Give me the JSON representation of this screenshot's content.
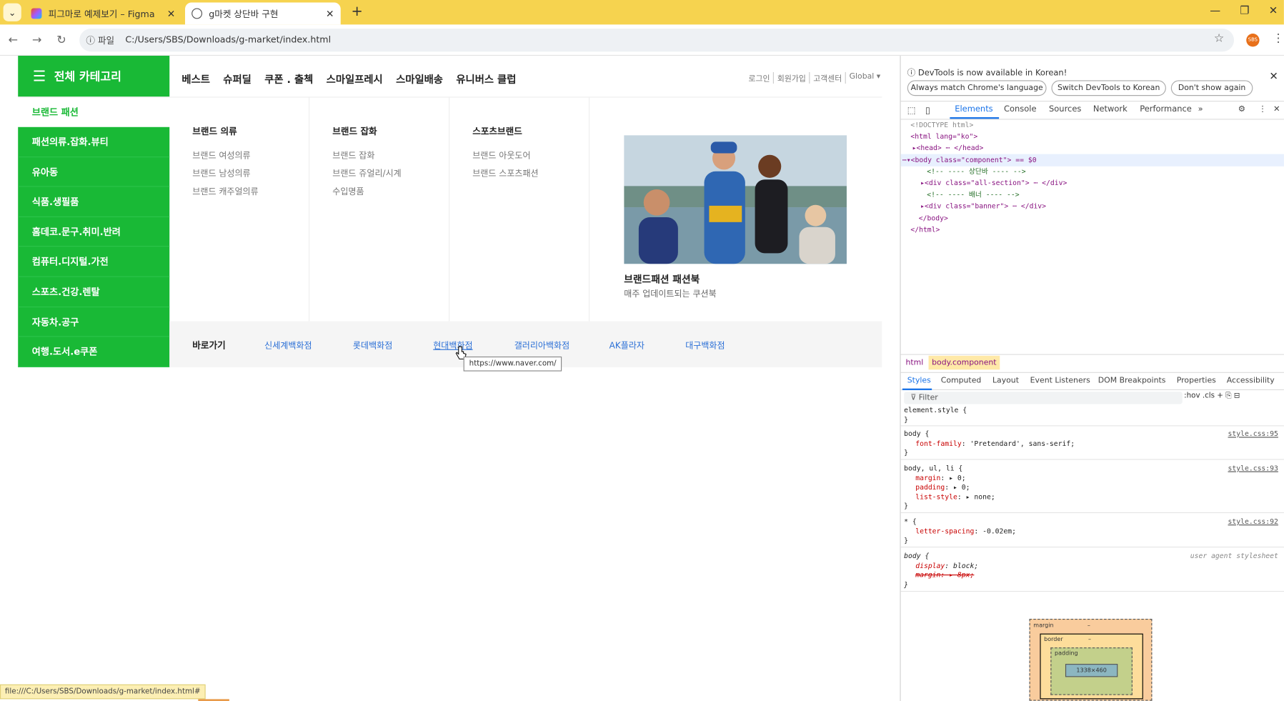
{
  "browser": {
    "tabs": [
      {
        "title": "피그마로 예제보기 – Figma",
        "close": "✕"
      },
      {
        "title": "g마켓 상단바 구현",
        "close": "✕"
      }
    ],
    "new_tab": "+",
    "window_controls": {
      "minimize": "—",
      "restore": "❐",
      "close": "✕"
    },
    "address": {
      "scheme_label": "ⓘ 파일",
      "url": "C:/Users/SBS/Downloads/g-market/index.html"
    },
    "profile_initials": "SBS",
    "status_url": "file:///C:/Users/SBS/Downloads/g-market/index.html#"
  },
  "page": {
    "all_category": "전체 카테고리",
    "gnb": [
      "베스트",
      "슈퍼딜",
      "쿠폰 . 출첵",
      "스마일프레시",
      "스마일배송",
      "유니버스 클럽"
    ],
    "util": [
      "로그인",
      "회원가입",
      "고객센터",
      "Global ▾"
    ],
    "categories": {
      "active": "브랜드 패션",
      "items": [
        "패션의류.잡화.뷰티",
        "유아동",
        "식품.생필품",
        "홈데코.문구.취미.반려",
        "컴퓨터.디지털.가전",
        "스포츠.건강.렌탈",
        "자동차.공구",
        "여행.도서.e쿠폰"
      ]
    },
    "mega": {
      "columns": [
        {
          "title": "브랜드 의류",
          "links": [
            "브랜드 여성의류",
            "브랜드 남성의류",
            "브랜드 캐주얼의류"
          ]
        },
        {
          "title": "브랜드 잡화",
          "links": [
            "브랜드 잡화",
            "브랜드 쥬얼리/시계",
            "수입명품"
          ]
        },
        {
          "title": "스포츠브랜드",
          "links": [
            "브랜드 아웃도어",
            "브랜드 스포츠패션"
          ]
        }
      ],
      "banner": {
        "title": "브랜드패션 패션북",
        "subtitle": "매주 업데이트되는 쿠션북"
      }
    },
    "shortcut": {
      "label": "바로가기",
      "links": [
        "신세계백화점",
        "롯데백화점",
        "현대백화점",
        "갤러리아백화점",
        "AK플라자",
        "대구백화점"
      ]
    },
    "tooltip": "https://www.naver.com/"
  },
  "devtools": {
    "notice": {
      "message": "ⓘ DevTools is now available in Korean!",
      "buttons": [
        "Always match Chrome's language",
        "Switch DevTools to Korean",
        "Don't show again"
      ],
      "close": "✕"
    },
    "tabs": [
      "Elements",
      "Console",
      "Sources",
      "Network",
      "Performance",
      "»"
    ],
    "elements": {
      "doctype": "<!DOCTYPE html>",
      "html_open": "<html lang=\"ko\">",
      "head": "▸<head> ⋯ </head>",
      "body_prefix": "⋯▾<body class=\"component\"> == $0",
      "comment1": "<!-- ---- 상단바 ---- -->",
      "div1": "▸<div class=\"all-section\"> ⋯ </div>",
      "comment2": "<!-- ---- 배너 ---- -->",
      "div2": "▸<div class=\"banner\"> ⋯ </div>",
      "body_close": "</body>",
      "html_close": "</html>"
    },
    "breadcrumbs": [
      "html",
      "body.component"
    ],
    "subtabs": [
      "Styles",
      "Computed",
      "Layout",
      "Event Listeners",
      "DOM Breakpoints",
      "Properties",
      "Accessibility"
    ],
    "filter_placeholder": "Filter",
    "filter_tools": ":hov  .cls  +  ⎘  ⊟",
    "rules": [
      {
        "selector": "element.style {",
        "close": "}",
        "props": [],
        "source": ""
      },
      {
        "selector": "body {",
        "close": "}",
        "props": [
          {
            "name": "font-family",
            "value": "'Pretendard', sans-serif;"
          }
        ],
        "source": "style.css:95"
      },
      {
        "selector": "body, ul, li {",
        "close": "}",
        "props": [
          {
            "name": "margin",
            "value": "▸ 0;"
          },
          {
            "name": "padding",
            "value": "▸ 0;"
          },
          {
            "name": "list-style",
            "value": "▸ none;"
          }
        ],
        "source": "style.css:93"
      },
      {
        "selector": "* {",
        "close": "}",
        "props": [
          {
            "name": "letter-spacing",
            "value": "-0.02em;"
          }
        ],
        "source": "style.css:92"
      },
      {
        "selector": "body {",
        "close": "}",
        "props": [
          {
            "name": "display",
            "value": "block;"
          },
          {
            "name": "margin",
            "value": "▸ 8px;"
          }
        ],
        "source": "user agent stylesheet"
      }
    ],
    "box_model": {
      "margin": "margin",
      "border": "border",
      "padding": "padding",
      "content": "1338×460",
      "dash": "–"
    }
  },
  "colors": {
    "accent_green": "#19b936",
    "browser_frame": "#f6d34f",
    "link_blue": "#2a6fd6",
    "devtools_blue": "#1a73e8"
  }
}
